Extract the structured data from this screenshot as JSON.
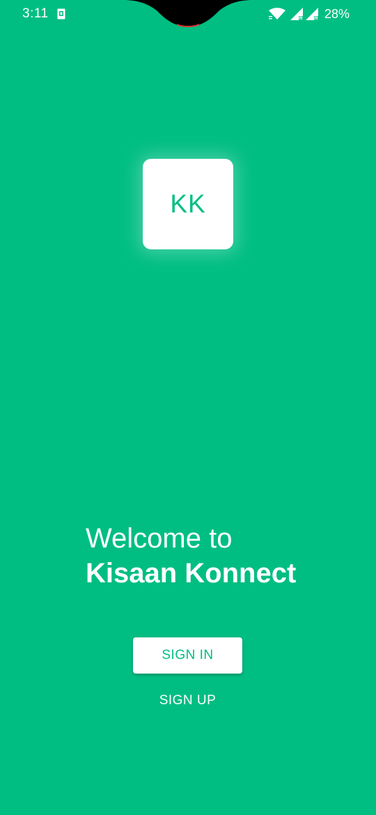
{
  "status_bar": {
    "time": "3:11",
    "battery": "28%",
    "icons": [
      "sim-card-icon",
      "wifi-icon",
      "signal-icon",
      "signal-icon"
    ]
  },
  "logo": {
    "text": "KK"
  },
  "welcome": {
    "line1": "Welcome to",
    "line2": "Kisaan Konnect"
  },
  "actions": {
    "sign_in_label": "SIGN IN",
    "sign_up_label": "SIGN UP"
  },
  "colors": {
    "background": "#00BE82",
    "surface": "#FFFFFF",
    "accent": "#00BE82",
    "text_on_background": "#FFFFFF"
  }
}
